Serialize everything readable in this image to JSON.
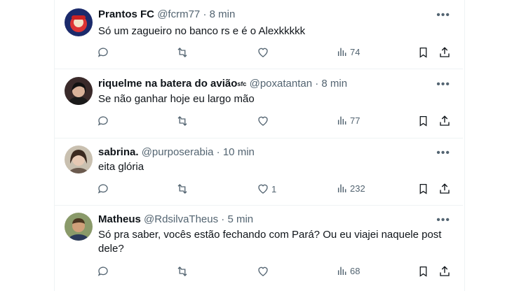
{
  "tweets": [
    {
      "name": "Prantos FC",
      "badge": "",
      "handle": "@fcrm77",
      "dot": "·",
      "time": "8 min",
      "text": "Só um zagueiro no banco rs e é o Alexkkkkk",
      "replies": "",
      "retweets": "",
      "likes": "",
      "views": "74"
    },
    {
      "name": "riquelme na batera do avião",
      "badge": "sfc",
      "handle": "@poxatantan",
      "dot": "·",
      "time": "8 min",
      "text": "Se não ganhar hoje eu largo mão",
      "replies": "",
      "retweets": "",
      "likes": "",
      "views": "77"
    },
    {
      "name": "sabrina.",
      "badge": "",
      "handle": "@purposerabia",
      "dot": "·",
      "time": "10 min",
      "text": "eita glória",
      "replies": "",
      "retweets": "",
      "likes": "1",
      "views": "232"
    },
    {
      "name": "Matheus",
      "badge": "",
      "handle": "@RdsilvaTheus",
      "dot": "·",
      "time": "5 min",
      "text": "Só pra saber, vocês estão fechando com Pará? Ou eu viajei naquele post dele?",
      "replies": "",
      "retweets": "",
      "likes": "",
      "views": "68"
    }
  ],
  "more_glyph": "•••",
  "icons": {
    "reply": "reply-icon",
    "retweet": "retweet-icon",
    "like": "heart-icon",
    "views": "views-icon",
    "bookmark": "bookmark-icon",
    "share": "share-icon",
    "more": "more-icon"
  },
  "colors": {
    "text": "#0f1419",
    "secondary": "#536471",
    "border": "#eff3f4"
  }
}
